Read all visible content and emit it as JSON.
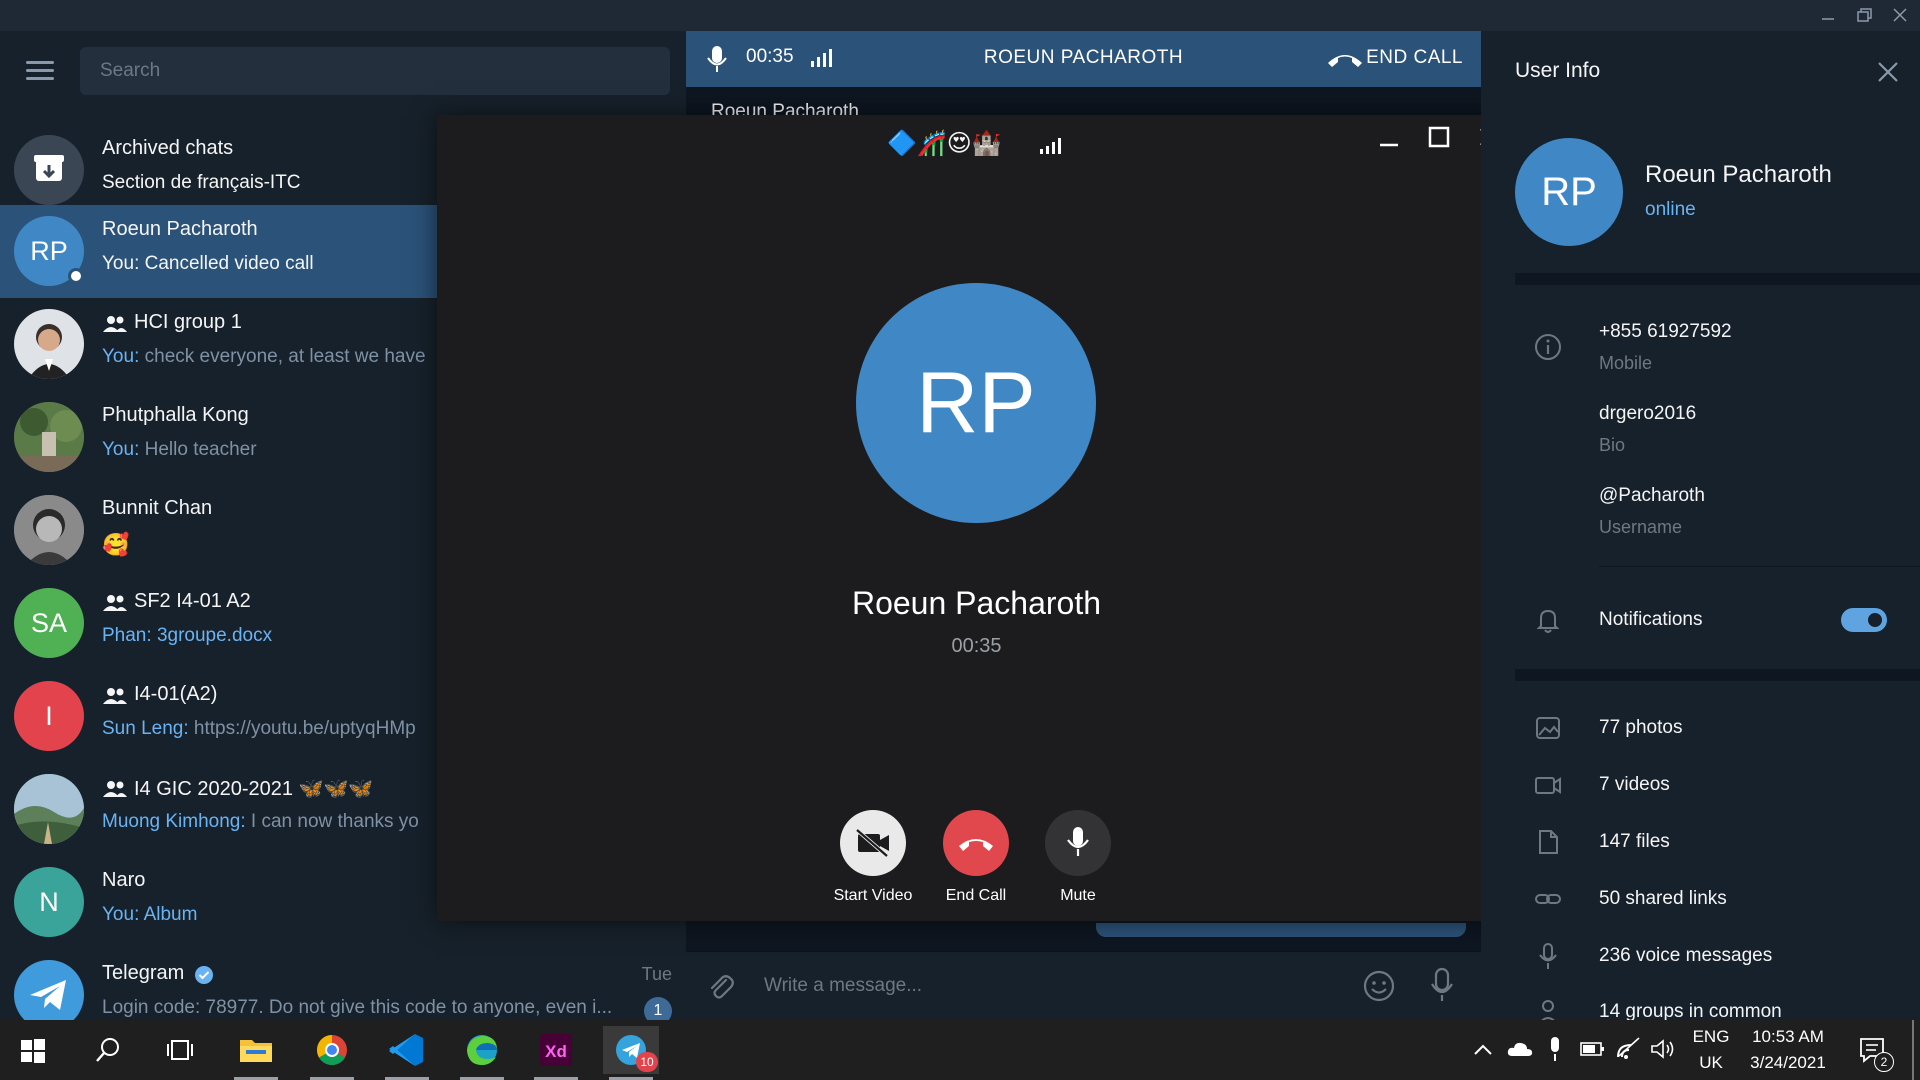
{
  "window": {
    "controls": [
      "minimize",
      "restore",
      "close"
    ]
  },
  "left": {
    "search_placeholder": "Search",
    "chats": [
      {
        "name": "Archived chats",
        "preview_sender": "",
        "preview": "Section de français-ITC",
        "avatar_text": "",
        "avatar_color": "#3a4654",
        "group": false
      },
      {
        "name": "Roeun Pacharoth",
        "preview_sender": "You: ",
        "preview": "Cancelled video call",
        "avatar_text": "RP",
        "avatar_color": "#3f88c5",
        "group": false,
        "active": true
      },
      {
        "name": "HCI group 1",
        "preview_sender": "You: ",
        "preview": "check everyone, at least we have",
        "avatar_text": "",
        "avatar_color": "#dfe3e8",
        "group": true
      },
      {
        "name": "Phutphalla Kong",
        "preview_sender": "You: ",
        "preview": "Hello teacher",
        "avatar_text": "",
        "avatar_color": "#4c6a3b",
        "group": false
      },
      {
        "name": "Bunnit Chan",
        "preview_sender": "",
        "preview": "🥰",
        "avatar_text": "",
        "avatar_color": "#6a6a6a",
        "group": false
      },
      {
        "name": "SF2 I4-01 A2",
        "preview_sender": "Phan: ",
        "preview": "3groupe.docx",
        "avatar_text": "SA",
        "avatar_color": "#4fb054",
        "group": true
      },
      {
        "name": "I4-01(A2)",
        "preview_sender": "Sun Leng: ",
        "preview": "https://youtu.be/uptyqHMp",
        "avatar_text": "I",
        "avatar_color": "#e2434c",
        "group": true
      },
      {
        "name": "I4 GIC 2020-2021 🦋🦋🦋",
        "preview_sender": "Muong Kimhong: ",
        "preview": "I can now thanks yo",
        "avatar_text": "",
        "avatar_color": "#6e8a73",
        "group": true
      },
      {
        "name": "Naro",
        "preview_sender": "You: ",
        "preview": "Album",
        "avatar_text": "N",
        "avatar_color": "#3aa39a",
        "group": false
      },
      {
        "name": "Telegram",
        "preview_sender": "",
        "preview": "Login code: 78977. Do not give this code to anyone, even i...",
        "avatar_text": "",
        "avatar_color": "#3f9bdb",
        "group": false,
        "date": "Tue",
        "badge": "1"
      }
    ]
  },
  "callbar": {
    "time": "00:35",
    "name": "ROEUN PACHAROTH",
    "end": "END CALL"
  },
  "chat": {
    "header_name": "Roeun Pacharoth",
    "composer_placeholder": "Write a message..."
  },
  "call": {
    "emojis": "🔷🎢😍🏰",
    "avatar_text": "RP",
    "name": "Roeun Pacharoth",
    "time": "00:35",
    "buttons": {
      "start_video": "Start Video",
      "end_call": "End Call",
      "mute": "Mute"
    }
  },
  "info": {
    "title": "User Info",
    "avatar_text": "RP",
    "name": "Roeun Pacharoth",
    "status": "online",
    "phone": "+855 61927592",
    "phone_label": "Mobile",
    "bio": "drgero2016",
    "bio_label": "Bio",
    "username": "@Pacharoth",
    "username_label": "Username",
    "notifications": "Notifications",
    "notifications_on": true,
    "media": {
      "photos": "77 photos",
      "videos": "7 videos",
      "files": "147 files",
      "links": "50 shared links",
      "voice": "236 voice messages",
      "groups": "14 groups in common"
    }
  },
  "taskbar": {
    "telegram_badge": "10",
    "lang_top": "ENG",
    "lang_bottom": "UK",
    "time": "10:53 AM",
    "date": "3/24/2021",
    "notif_badge": "2"
  },
  "colors": {
    "accent": "#2b5278",
    "avatar_blue": "#3f88c5",
    "end_red": "#e0484d",
    "link": "#6ab3f3"
  }
}
